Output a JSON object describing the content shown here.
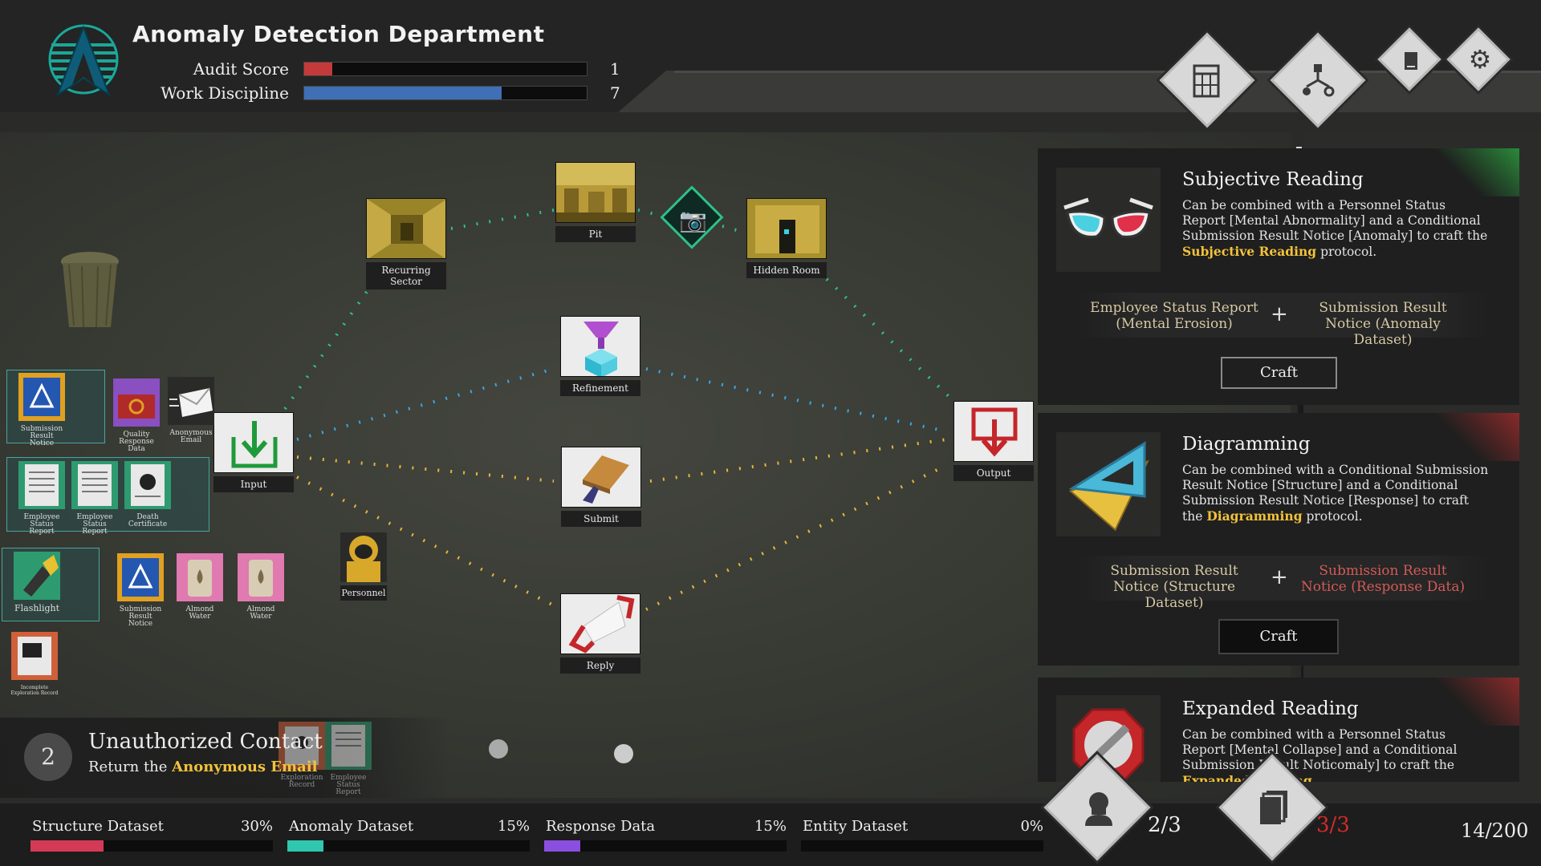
{
  "header": {
    "title": "Anomaly Detection Department",
    "stats": [
      {
        "label": "Audit Score",
        "value": "1",
        "fill": 0.1,
        "color": "#c43a3a"
      },
      {
        "label": "Work Discipline",
        "value": "7",
        "fill": 0.7,
        "color": "#3f6fb4"
      }
    ],
    "buttons": [
      {
        "icon": "document-grid-icon"
      },
      {
        "icon": "flowchart-icon"
      },
      {
        "icon": "book-icon"
      },
      {
        "icon": "gear-icon"
      }
    ]
  },
  "nodes": {
    "recurring_sector": "Recurring Sector",
    "pit": "Pit",
    "hidden_room": "Hidden Room",
    "refinement": "Refinement",
    "input": "Input",
    "submit": "Submit",
    "output": "Output",
    "reply": "Reply",
    "personnel": "Personnel"
  },
  "inventory": {
    "row1": [
      {
        "label": "Submission Result Notice"
      },
      {
        "label": "Quality Response Data"
      },
      {
        "label": "Anonymous Email"
      }
    ],
    "row2": [
      {
        "label": "Employee Status Report"
      },
      {
        "label": "Employee Status Report"
      },
      {
        "label": "Death Certificate"
      }
    ],
    "row3": [
      {
        "label": "Flashlight"
      },
      {
        "label": "Submission Result Notice"
      },
      {
        "label": "Almond Water"
      },
      {
        "label": "Almond Water"
      }
    ],
    "row4": [
      {
        "label": "Incomplete Exploration Record"
      }
    ],
    "floating": [
      {
        "label": "Exploration Record"
      },
      {
        "label": "Employee Status Report"
      }
    ]
  },
  "quest": {
    "number": "2",
    "title": "Unauthorized Contact",
    "desc_prefix": "Return the ",
    "desc_highlight": "Anonymous Email"
  },
  "recipes": [
    {
      "title": "Subjective Reading",
      "desc_a": "Can be combined with a Personnel Status Report [Mental Abnormality] and a Conditional Submission Result Notice [Anomaly] to craft the ",
      "desc_hl": "Subjective Reading",
      "desc_b": " protocol.",
      "ing1": "Employee Status Report (Mental Erosion)",
      "ing2": "Submission Result Notice (Anomaly Dataset)",
      "plus": "+",
      "craft": "Craft",
      "accent": "#2a8a3a"
    },
    {
      "title": "Diagramming",
      "desc_a": "Can be combined with a Conditional Submission Result Notice [Structure] and a Conditional Submission Result Notice [Response] to craft the ",
      "desc_hl": "Diagramming",
      "desc_b": " protocol.",
      "ing1": "Submission Result Notice (Structure Dataset)",
      "ing2": "Submission Result Notice (Response Data)",
      "plus": "+",
      "craft": "Craft",
      "accent": "#8a2a2a"
    },
    {
      "title": "Expanded Reading",
      "desc_a": "Can be combined with a Personnel Status Report [Mental Collapse] and a Conditional Submission Result Notic",
      "desc_mid": "omaly] to craft the ",
      "desc_hl": "Expanded Reading",
      "accent": "#8a2a2a"
    }
  ],
  "datasets": [
    {
      "label": "Structure Dataset",
      "pct": "30%",
      "fill": 0.3,
      "color": "#d43a55"
    },
    {
      "label": "Anomaly Dataset",
      "pct": "15%",
      "fill": 0.15,
      "color": "#2fc7b0"
    },
    {
      "label": "Response Data",
      "pct": "15%",
      "fill": 0.15,
      "color": "#8a4fe0"
    },
    {
      "label": "Entity Dataset",
      "pct": "0%",
      "fill": 0.0,
      "color": "#888888"
    }
  ],
  "counters": {
    "personnel": "2/3",
    "cards": "3/3",
    "total": "14/200"
  }
}
